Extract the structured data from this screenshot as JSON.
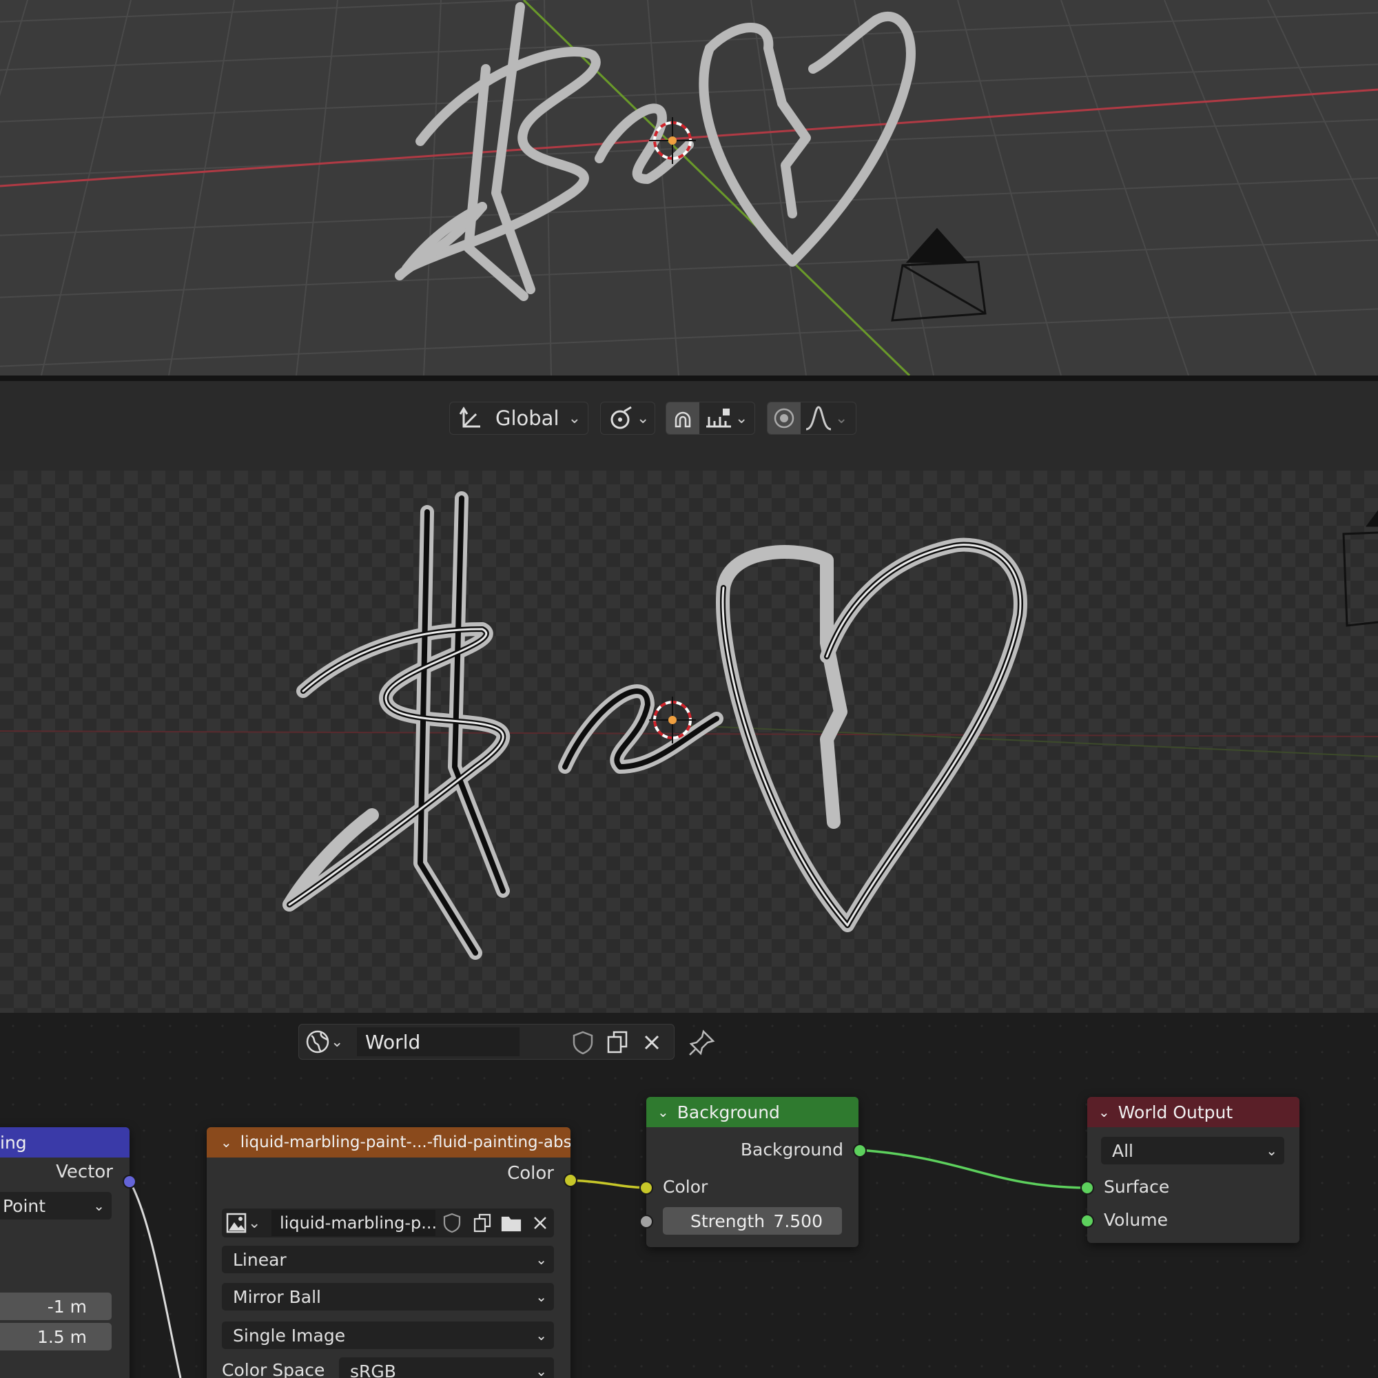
{
  "viewport_header": {
    "orientation_label": "Global"
  },
  "world_bar": {
    "world_name": "World"
  },
  "nodes": {
    "mapping": {
      "title": "ing",
      "output_vector": "Vector",
      "type_value": "Point",
      "loc_y": "-1 m",
      "loc_z": "1.5 m"
    },
    "image_texture": {
      "title": "liquid-marbling-paint-...-fluid-painting-abstrac",
      "output_color": "Color",
      "image_name": "liquid-marbling-p...",
      "interpolation": "Linear",
      "projection": "Mirror Ball",
      "source": "Single Image",
      "color_space_label": "Color Space",
      "color_space_value": "sRGB"
    },
    "background": {
      "title": "Background",
      "output_label": "Background",
      "input_color": "Color",
      "strength_label": "Strength",
      "strength_value": "7.500"
    },
    "world_output": {
      "title": "World Output",
      "target": "All",
      "input_surface": "Surface",
      "input_volume": "Volume"
    }
  },
  "colors": {
    "mapping_header": "#3a3aa8",
    "texture_header": "#8a4a1c",
    "background_header": "#2f7a2f",
    "output_header": "#5a1f28",
    "socket_vector": "#6464d8",
    "socket_color": "#c7c729",
    "socket_shader": "#5dd15d",
    "socket_float": "#a1a1a1"
  }
}
